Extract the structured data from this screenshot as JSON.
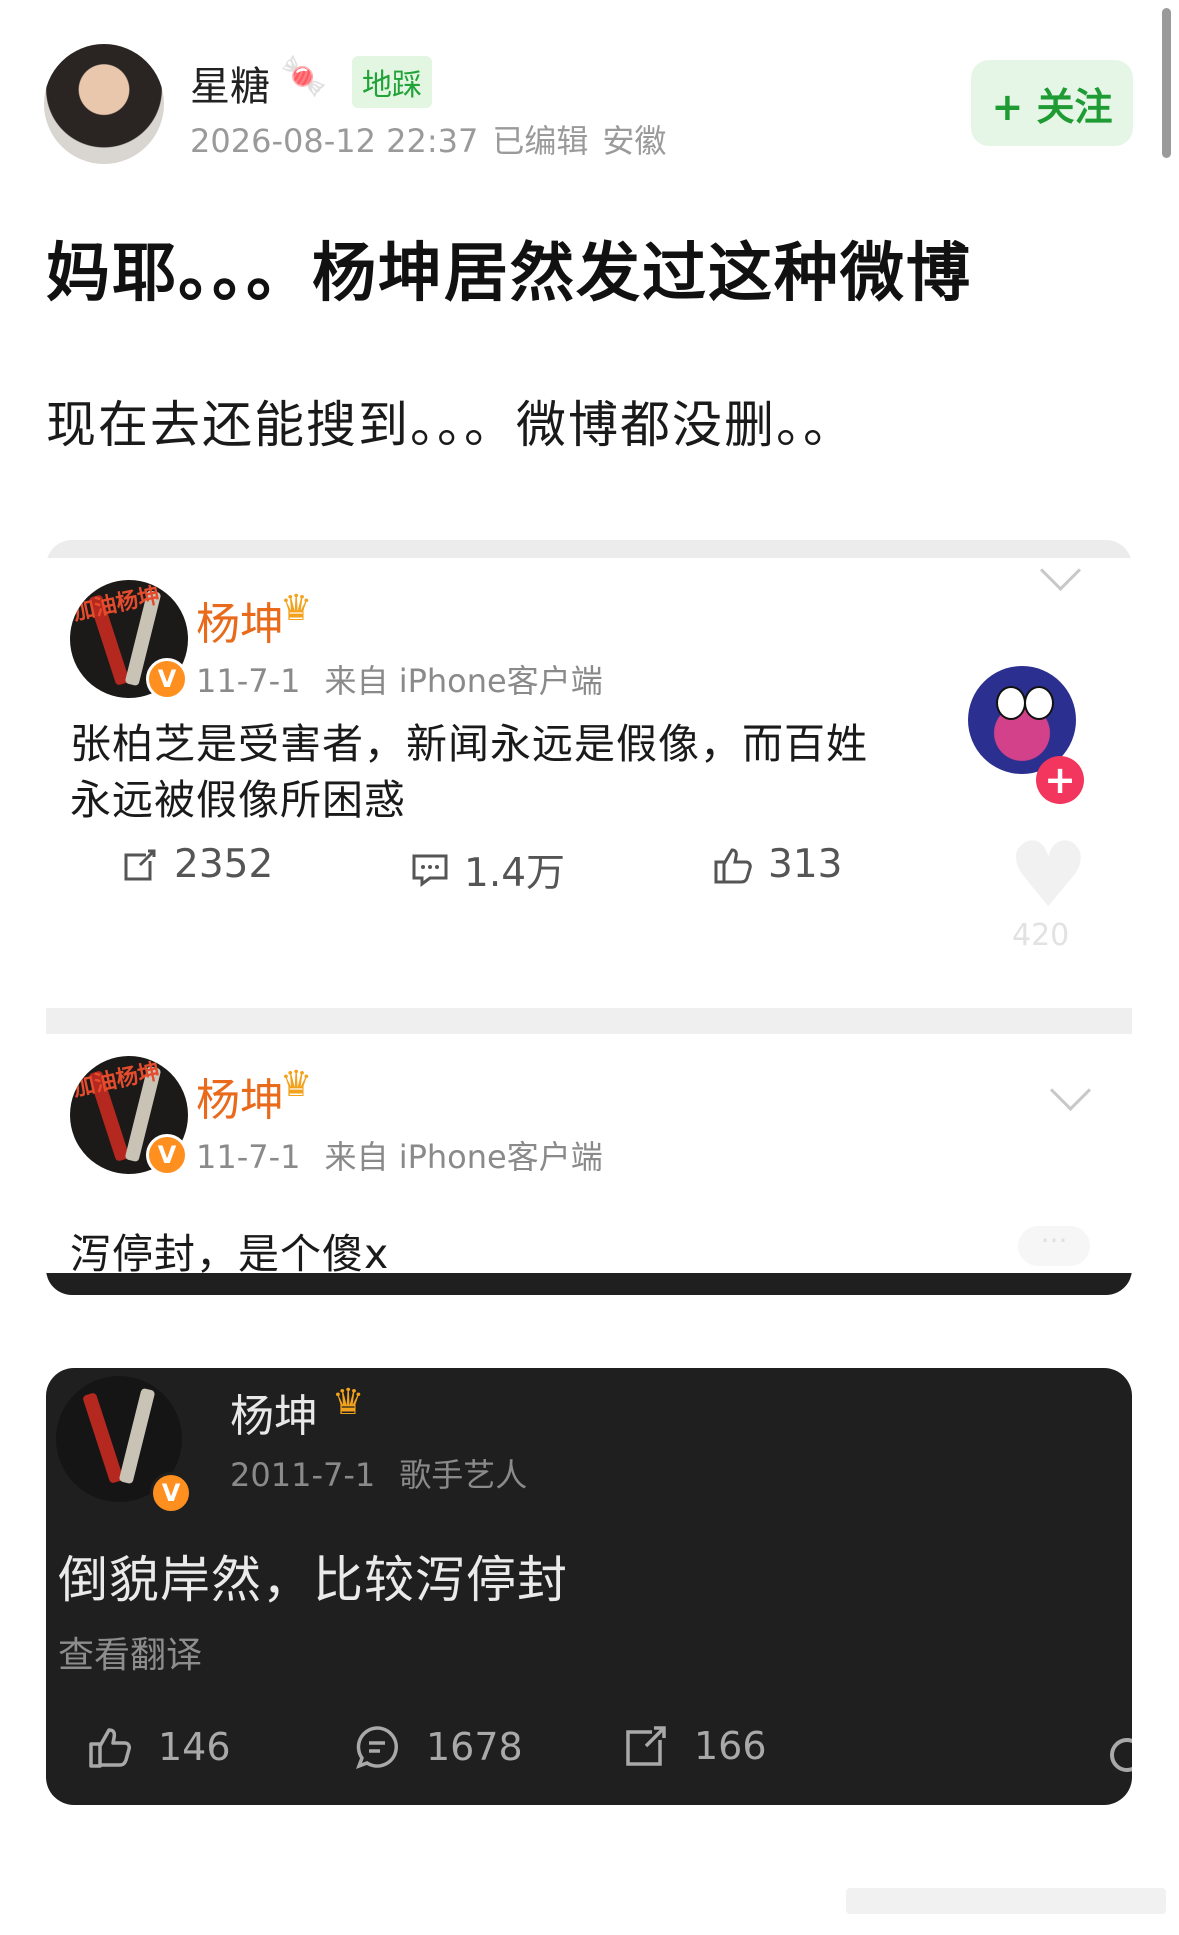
{
  "post": {
    "author": {
      "name": "星糖",
      "badge": "地踩",
      "candy_icon": "candy-icon",
      "timestamp": "2026-08-12 22:37",
      "edited": "已编辑",
      "location": "安徽"
    },
    "follow_label": "+ 关注",
    "title": "妈耶。。。杨坤居然发过这种微博",
    "body": "现在去还能搜到。。。微博都没删。。"
  },
  "screenshot_light": {
    "weibo_1": {
      "name": "杨坤",
      "date": "11-7-1",
      "source": "来自 iPhone客户端",
      "text": "张柏芝是受害者，新闻永远是假像，而百姓永远被假像所困惑",
      "reposts": "2352",
      "comments": "1.4万",
      "likes": "313"
    },
    "weibo_2": {
      "name": "杨坤",
      "date": "11-7-1",
      "source": "来自 iPhone客户端",
      "text": "泻停封，是个傻x"
    },
    "overlay_like_count": "420",
    "avatar_scribble": "加油杨坤"
  },
  "screenshot_dark": {
    "name": "杨坤",
    "date": "2011-7-1",
    "role": "歌手艺人",
    "text": "倒貌岸然，比较泻停封",
    "translate": "查看翻译",
    "likes": "146",
    "comments": "1678",
    "shares": "166"
  },
  "colors": {
    "follow_green": "#1f9b34",
    "weibo_name_orange": "#e86a1a",
    "verified_orange": "#ff8f1f",
    "dark_card": "#1f1f1f"
  }
}
